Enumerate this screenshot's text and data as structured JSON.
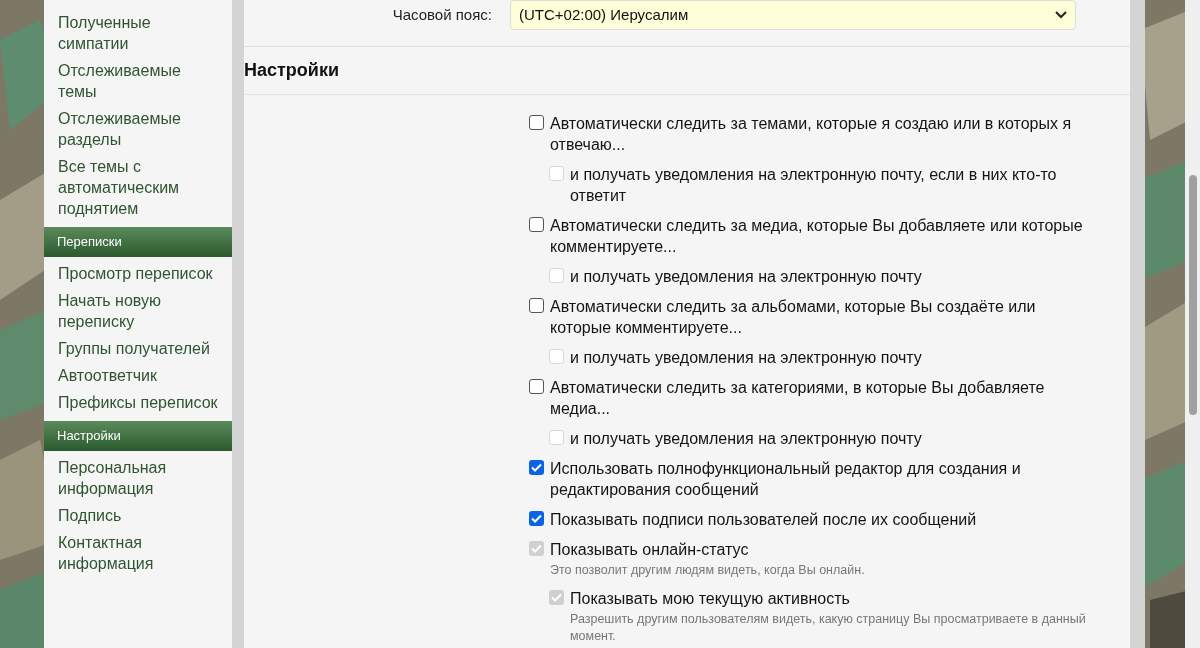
{
  "sidebar": {
    "sections": [
      {
        "items": [
          "Полученные симпатии",
          "Отслеживаемые темы",
          "Отслеживаемые разделы",
          "Все темы с автоматическим поднятием"
        ]
      },
      {
        "heading": "Переписки",
        "items": [
          "Просмотр переписок",
          "Начать новую переписку",
          "Группы получателей",
          "Автоответчик",
          "Префиксы переписок"
        ]
      },
      {
        "heading": "Настройки",
        "items": [
          "Персональная информация",
          "Подпись",
          "Контактная информация"
        ]
      }
    ]
  },
  "timezone": {
    "label": "Часовой пояс:",
    "value": "(UTC+02:00) Иерусалим"
  },
  "section_title": "Настройки",
  "options": [
    {
      "kind": "main",
      "label": "Автоматически следить за темами, которые я создаю или в которых я отвечаю...",
      "checked": false,
      "disabled": false
    },
    {
      "kind": "sub",
      "label": "и получать уведомления на электронную почту, если в них кто-то ответит",
      "checked": false,
      "disabled": true
    },
    {
      "kind": "main",
      "label": "Автоматически следить за медиа, которые Вы добавляете или которые комментируете...",
      "checked": false,
      "disabled": false
    },
    {
      "kind": "sub",
      "label": "и получать уведомления на электронную почту",
      "checked": false,
      "disabled": true
    },
    {
      "kind": "main",
      "label": "Автоматически следить за альбомами, которые Вы создаёте или которые комментируете...",
      "checked": false,
      "disabled": false
    },
    {
      "kind": "sub",
      "label": "и получать уведомления на электронную почту",
      "checked": false,
      "disabled": true
    },
    {
      "kind": "main",
      "label": "Автоматически следить за категориями, в которые Вы добавляете медиа...",
      "checked": false,
      "disabled": false
    },
    {
      "kind": "sub",
      "label": "и получать уведомления на электронную почту",
      "checked": false,
      "disabled": true
    },
    {
      "kind": "main",
      "label": "Использовать полнофункциональный редактор для создания и редактирования сообщений",
      "checked": true,
      "disabled": false
    },
    {
      "kind": "main",
      "label": "Показывать подписи пользователей после их сообщений",
      "checked": true,
      "disabled": false
    },
    {
      "kind": "main",
      "label": "Показывать онлайн-статус",
      "checked": true,
      "disabled": true,
      "hint": "Это позволит другим людям видеть, когда Вы онлайн."
    },
    {
      "kind": "sub",
      "label": "Показывать мою текущую активность",
      "checked": true,
      "disabled": true,
      "hint": "Разрешить другим пользователям видеть, какую страницу Вы просматриваете в данный момент."
    }
  ]
}
